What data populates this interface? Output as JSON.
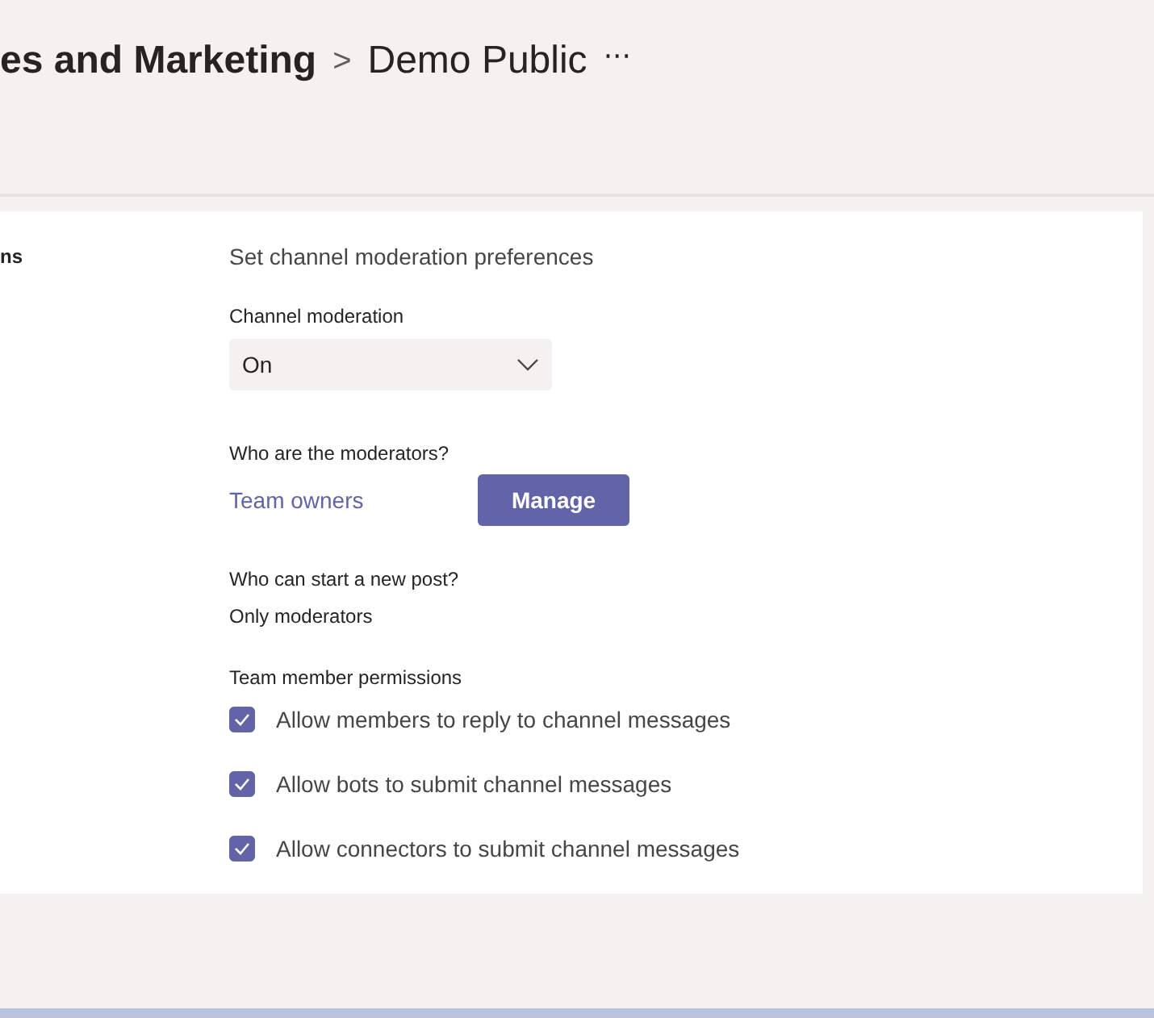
{
  "breadcrumb": {
    "team": "es and Marketing",
    "separator": ">",
    "channel": "Demo Public",
    "more": "···"
  },
  "section": {
    "label": "ns",
    "heading": "Set channel moderation preferences"
  },
  "moderation": {
    "label": "Channel moderation",
    "value": "On"
  },
  "moderators": {
    "label": "Who are the moderators?",
    "link": "Team owners",
    "button": "Manage"
  },
  "posting": {
    "label": "Who can start a new post?",
    "value": "Only moderators"
  },
  "permissions": {
    "label": "Team member permissions",
    "items": [
      {
        "label": "Allow members to reply to channel messages",
        "checked": true
      },
      {
        "label": "Allow bots to submit channel messages",
        "checked": true
      },
      {
        "label": "Allow connectors to submit channel messages",
        "checked": true
      }
    ]
  }
}
